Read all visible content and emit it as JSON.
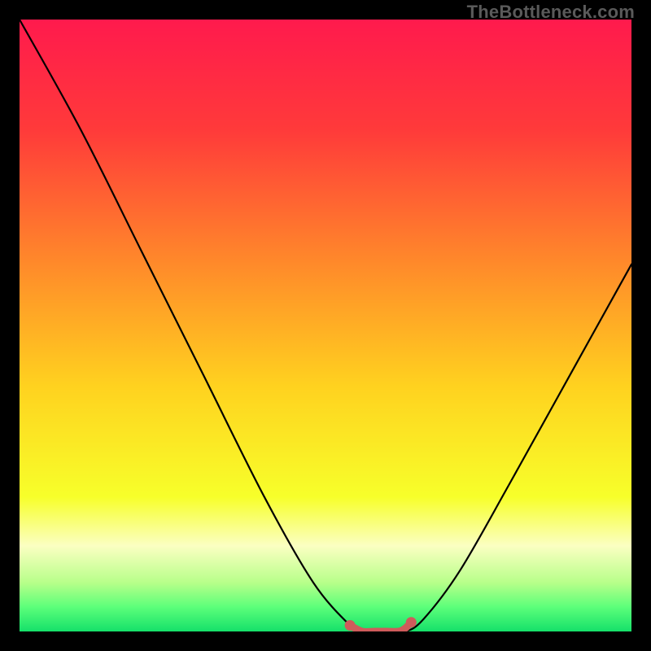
{
  "watermark": "TheBottleneck.com",
  "chart_data": {
    "type": "line",
    "title": "",
    "xlabel": "",
    "ylabel": "",
    "legend": false,
    "grid": false,
    "xlim": [
      0,
      100
    ],
    "ylim": [
      0,
      100
    ],
    "note": "Bottleneck-style curve: V-shape that dips to ~0 around x≈55–63 then rises again; no visible axis ticks or numeric labels.",
    "series": [
      {
        "name": "bottleneck-curve",
        "color": "#000000",
        "x": [
          0,
          10,
          20,
          30,
          40,
          48,
          54,
          56,
          60,
          63,
          66,
          72,
          80,
          90,
          100
        ],
        "y": [
          100,
          82,
          62,
          42,
          22,
          8,
          1,
          0,
          0,
          0,
          2,
          10,
          24,
          42,
          60
        ]
      },
      {
        "name": "highlight-flat",
        "color": "#cf5b5b",
        "x": [
          54,
          56,
          58,
          60,
          62,
          63,
          64
        ],
        "y": [
          1,
          0,
          0,
          0,
          0,
          0.5,
          1.5
        ]
      }
    ],
    "background_gradient": {
      "type": "vertical",
      "stops": [
        {
          "pos": 0.0,
          "color": "#ff1a4d"
        },
        {
          "pos": 0.18,
          "color": "#ff3a3a"
        },
        {
          "pos": 0.4,
          "color": "#ff8a2a"
        },
        {
          "pos": 0.6,
          "color": "#ffd21f"
        },
        {
          "pos": 0.78,
          "color": "#f7ff2a"
        },
        {
          "pos": 0.86,
          "color": "#fbffc2"
        },
        {
          "pos": 0.92,
          "color": "#b8ff8a"
        },
        {
          "pos": 0.96,
          "color": "#5cff7a"
        },
        {
          "pos": 1.0,
          "color": "#15e06a"
        }
      ]
    }
  }
}
